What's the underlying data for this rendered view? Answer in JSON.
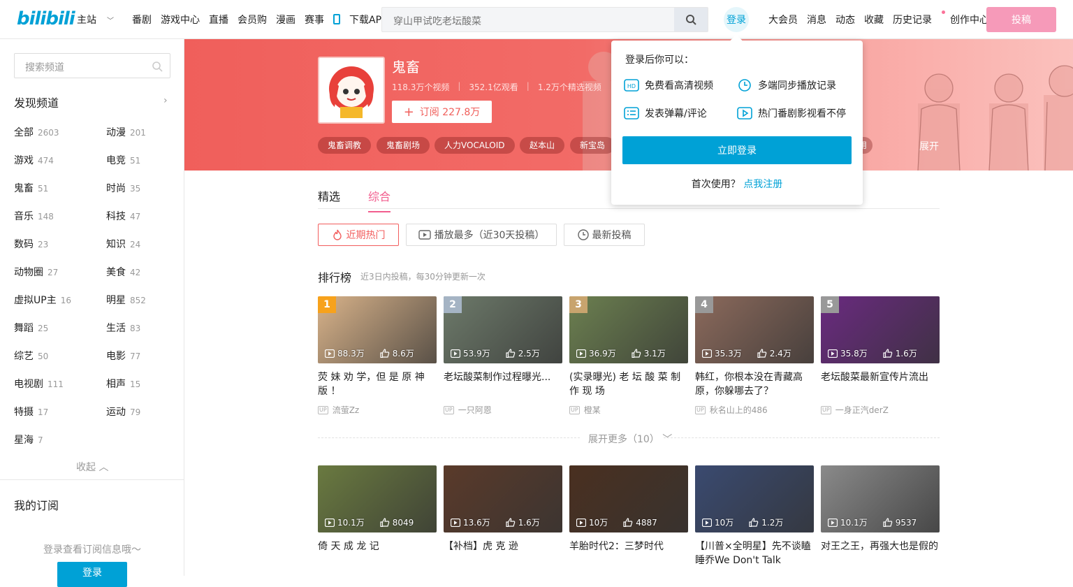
{
  "header": {
    "logo": "bilibili",
    "nav": [
      "主站",
      "番剧",
      "游戏中心",
      "直播",
      "会员购",
      "漫画",
      "赛事",
      "下载APP"
    ],
    "search_placeholder": "穿山甲试吃老坛酸菜",
    "login": "登录",
    "right_nav": [
      "大会员",
      "消息",
      "动态",
      "收藏",
      "历史记录",
      "创作中心"
    ],
    "post": "投稿"
  },
  "sidebar": {
    "search_placeholder": "搜索频道",
    "discover": "发现频道",
    "categories": [
      {
        "name": "全部",
        "count": "2603"
      },
      {
        "name": "动漫",
        "count": "201"
      },
      {
        "name": "游戏",
        "count": "474"
      },
      {
        "name": "电竞",
        "count": "51"
      },
      {
        "name": "鬼畜",
        "count": "51"
      },
      {
        "name": "时尚",
        "count": "35"
      },
      {
        "name": "音乐",
        "count": "148"
      },
      {
        "name": "科技",
        "count": "47"
      },
      {
        "name": "数码",
        "count": "23"
      },
      {
        "name": "知识",
        "count": "24"
      },
      {
        "name": "动物圈",
        "count": "27"
      },
      {
        "name": "美食",
        "count": "42"
      },
      {
        "name": "虚拟UP主",
        "count": "16"
      },
      {
        "name": "明星",
        "count": "852"
      },
      {
        "name": "舞蹈",
        "count": "25"
      },
      {
        "name": "生活",
        "count": "83"
      },
      {
        "name": "综艺",
        "count": "50"
      },
      {
        "name": "电影",
        "count": "77"
      },
      {
        "name": "电视剧",
        "count": "111"
      },
      {
        "name": "相声",
        "count": "15"
      },
      {
        "name": "特摄",
        "count": "17"
      },
      {
        "name": "运动",
        "count": "79"
      },
      {
        "name": "星海",
        "count": "7"
      }
    ],
    "collapse": "收起",
    "my_sub": "我的订阅",
    "sub_hint": "登录查看订阅信息哦～",
    "login": "登录"
  },
  "channel": {
    "title": "鬼畜",
    "videos": "118.3万个视频",
    "views": "352.1亿观看",
    "featured": "1.2万个精选视频",
    "subscribe": "订阅 227.8万",
    "tags": [
      "鬼畜调教",
      "鬼畜剧场",
      "人力VOCALOID",
      "赵本山",
      "新宝岛"
    ],
    "tag_partial": "使用",
    "expand": "展开"
  },
  "tabs": [
    "精选",
    "综合"
  ],
  "filters": [
    "近期热门",
    "播放最多（近30天投稿）",
    "最新投稿"
  ],
  "ranking": {
    "title": "排行榜",
    "subtitle": "近3日内投稿，每30分钟更新一次",
    "more": "展开更多（10）"
  },
  "cards_top": [
    {
      "rank": "1",
      "views": "88.3万",
      "likes": "8.6万",
      "title": "荧 妹 劝 学，但 是 原 神 版 ！",
      "up": "流萤Zz",
      "color": "#d9b38a",
      "rank_color": "#f7a21c"
    },
    {
      "rank": "2",
      "views": "53.9万",
      "likes": "2.5万",
      "title": "老坛酸菜制作过程曝光...",
      "up": "一只阿恩",
      "color": "#6d7a6a",
      "rank_color": "#a5b4c4"
    },
    {
      "rank": "3",
      "views": "36.9万",
      "likes": "3.1万",
      "title": "(实录曝光) 老 坛 酸 菜 制 作 现 场",
      "up": "橙某",
      "color": "#6c8050",
      "rank_color": "#c8a46e"
    },
    {
      "rank": "4",
      "views": "35.3万",
      "likes": "2.4万",
      "title": "韩红，你根本没在青藏高原，你躲哪去了？",
      "up": "秋名山上的486",
      "color": "#8c6a5c",
      "rank_color": "#999"
    },
    {
      "rank": "5",
      "views": "35.8万",
      "likes": "1.6万",
      "title": "老坛酸菜最新宣传片流出",
      "up": "一身正汽derZ",
      "color": "#6a2a80",
      "rank_color": "#999"
    }
  ],
  "cards_bottom": [
    {
      "views": "10.1万",
      "likes": "8049",
      "title": "倚 天 成 龙 记",
      "color": "#6a7a40"
    },
    {
      "views": "13.6万",
      "likes": "1.6万",
      "title": "【补档】虎 克 逊",
      "color": "#5a3a2a"
    },
    {
      "views": "10万",
      "likes": "4887",
      "title": "羊胎时代2：三梦时代",
      "color": "#4a3020"
    },
    {
      "views": "10万",
      "likes": "1.2万",
      "title": "【川普×全明星】先不谈瞌睡乔We Don't Talk About...",
      "color": "#3a4a70"
    },
    {
      "views": "10.1万",
      "likes": "9537",
      "title": "对王之王，再强大也是假的",
      "color": "#8a8a8a"
    }
  ],
  "popup": {
    "header": "登录后你可以：",
    "items": [
      "免费看高清视频",
      "多端同步播放记录",
      "发表弹幕/评论",
      "热门番剧影视看不停"
    ],
    "button": "立即登录",
    "first_use": "首次使用？",
    "register": "点我注册"
  }
}
